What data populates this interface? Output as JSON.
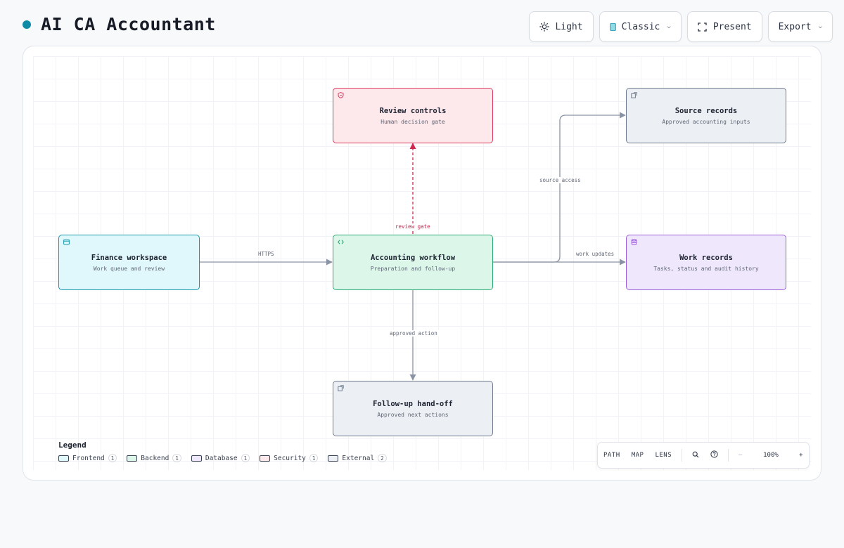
{
  "app": {
    "title": "AI CA Accountant",
    "accent": "#0e8aa6"
  },
  "toolbar": {
    "light_label": "Light",
    "theme_label": "Classic",
    "present_label": "Present",
    "export_label": "Export"
  },
  "nodes": {
    "review": {
      "title": "Review controls",
      "subtitle": "Human decision gate",
      "type": "security",
      "icon": "shield-icon"
    },
    "source": {
      "title": "Source records",
      "subtitle": "Approved accounting inputs",
      "type": "external",
      "icon": "external-link-icon"
    },
    "finance": {
      "title": "Finance workspace",
      "subtitle": "Work queue and review",
      "type": "frontend",
      "icon": "browser-window-icon"
    },
    "workflow": {
      "title": "Accounting workflow",
      "subtitle": "Preparation and follow-up",
      "type": "backend",
      "icon": "code-icon"
    },
    "work": {
      "title": "Work records",
      "subtitle": "Tasks, status and audit history",
      "type": "database",
      "icon": "database-icon"
    },
    "followup": {
      "title": "Follow-up hand-off",
      "subtitle": "Approved next actions",
      "type": "external",
      "icon": "external-link-icon"
    }
  },
  "edges": {
    "https": {
      "from": "finance",
      "to": "workflow",
      "label": "HTTPS"
    },
    "review_gate": {
      "from": "workflow",
      "to": "review",
      "label": "review gate",
      "style": "dashed"
    },
    "source_access": {
      "from": "workflow",
      "to": "source",
      "label": "source access"
    },
    "work_updates": {
      "from": "workflow",
      "to": "work",
      "label": "work updates"
    },
    "approved_action": {
      "from": "workflow",
      "to": "followup",
      "label": "approved action"
    }
  },
  "legend": {
    "title": "Legend",
    "items": [
      {
        "label": "Frontend",
        "count": "1",
        "color": "#1798aa"
      },
      {
        "label": "Backend",
        "count": "1",
        "color": "#2aa873"
      },
      {
        "label": "Database",
        "count": "1",
        "color": "#9b5ed8"
      },
      {
        "label": "Security",
        "count": "1",
        "color": "#d93a5e"
      },
      {
        "label": "External",
        "count": "2",
        "color": "#6f7a8c"
      }
    ]
  },
  "mapbar": {
    "path_label": "PATH",
    "map_label": "MAP",
    "lens_label": "LENS",
    "zoom_out": "—",
    "zoom": "100%",
    "zoom_in": "+"
  }
}
